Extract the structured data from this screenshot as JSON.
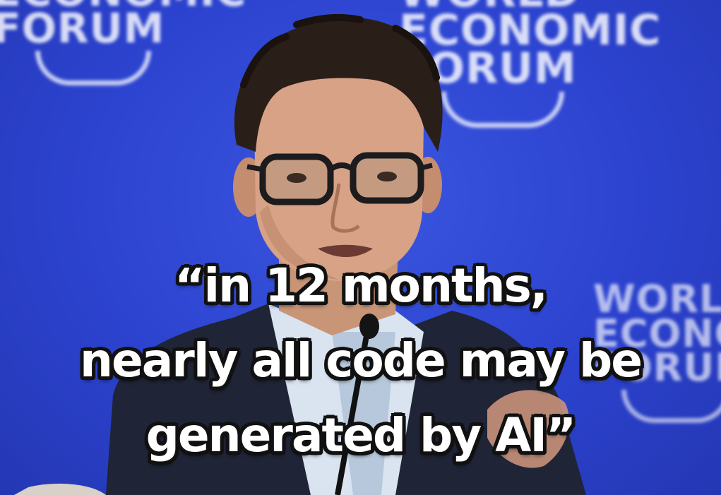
{
  "background": {
    "logos": [
      {
        "lines": [
          "ECONOMIC",
          "FORUM"
        ]
      },
      {
        "lines": [
          "WORLD",
          "ECONOMIC",
          "FORUM"
        ]
      },
      {
        "lines": [
          "WORLD",
          "ECONOMIC",
          "FORUM"
        ]
      }
    ],
    "color": "#2f45c9"
  },
  "caption": {
    "lines": [
      "“in 12 months,",
      "nearly all code may be",
      "generated by AI”"
    ],
    "text_color": "#ffffff",
    "outline_color": "#111111"
  }
}
